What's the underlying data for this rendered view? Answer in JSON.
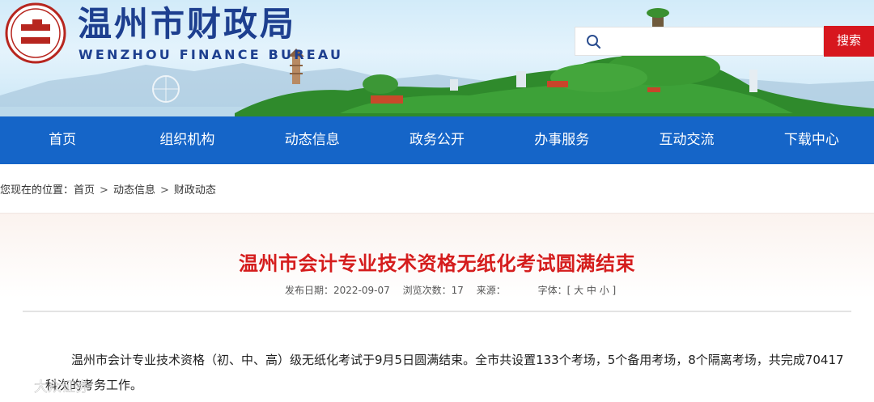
{
  "header": {
    "title": "温州市财政局",
    "subtitle": "WENZHOU FINANCE BUREAU",
    "logo_text": "温州财政",
    "search": {
      "placeholder": "",
      "button_label": "搜索"
    }
  },
  "nav": {
    "items": [
      {
        "label": "首页"
      },
      {
        "label": "组织机构"
      },
      {
        "label": "动态信息"
      },
      {
        "label": "政务公开"
      },
      {
        "label": "办事服务"
      },
      {
        "label": "互动交流"
      },
      {
        "label": "下载中心"
      }
    ]
  },
  "breadcrumb": {
    "prefix": "您现在的位置：",
    "items": [
      "首页",
      "动态信息",
      "财政动态"
    ],
    "separator": ">"
  },
  "article": {
    "title": "温州市会计专业技术资格无纸化考试圆满结束",
    "meta": {
      "date_label": "发布日期：",
      "date": "2022-09-07",
      "views_label": "浏览次数：",
      "views": "17",
      "source_label": "来源：",
      "source": "",
      "font_label": "字体：",
      "font_sizes": "[ 大 中 小 ]"
    },
    "paragraph": "温州市会计专业技术资格（初、中、高）级无纸化考试于9月5日圆满结束。全市共设置133个考场，5个备用考场，8个隔离考场，共完成70417科次的考务工作。"
  },
  "watermark": {
    "text": "大众证券"
  },
  "colors": {
    "brand_blue": "#1d3f8f",
    "nav_blue": "#1565c8",
    "search_red": "#d7171e",
    "title_red": "#d51d1d"
  },
  "icons": {
    "search": "search-icon",
    "logo": "seal-logo-icon"
  }
}
